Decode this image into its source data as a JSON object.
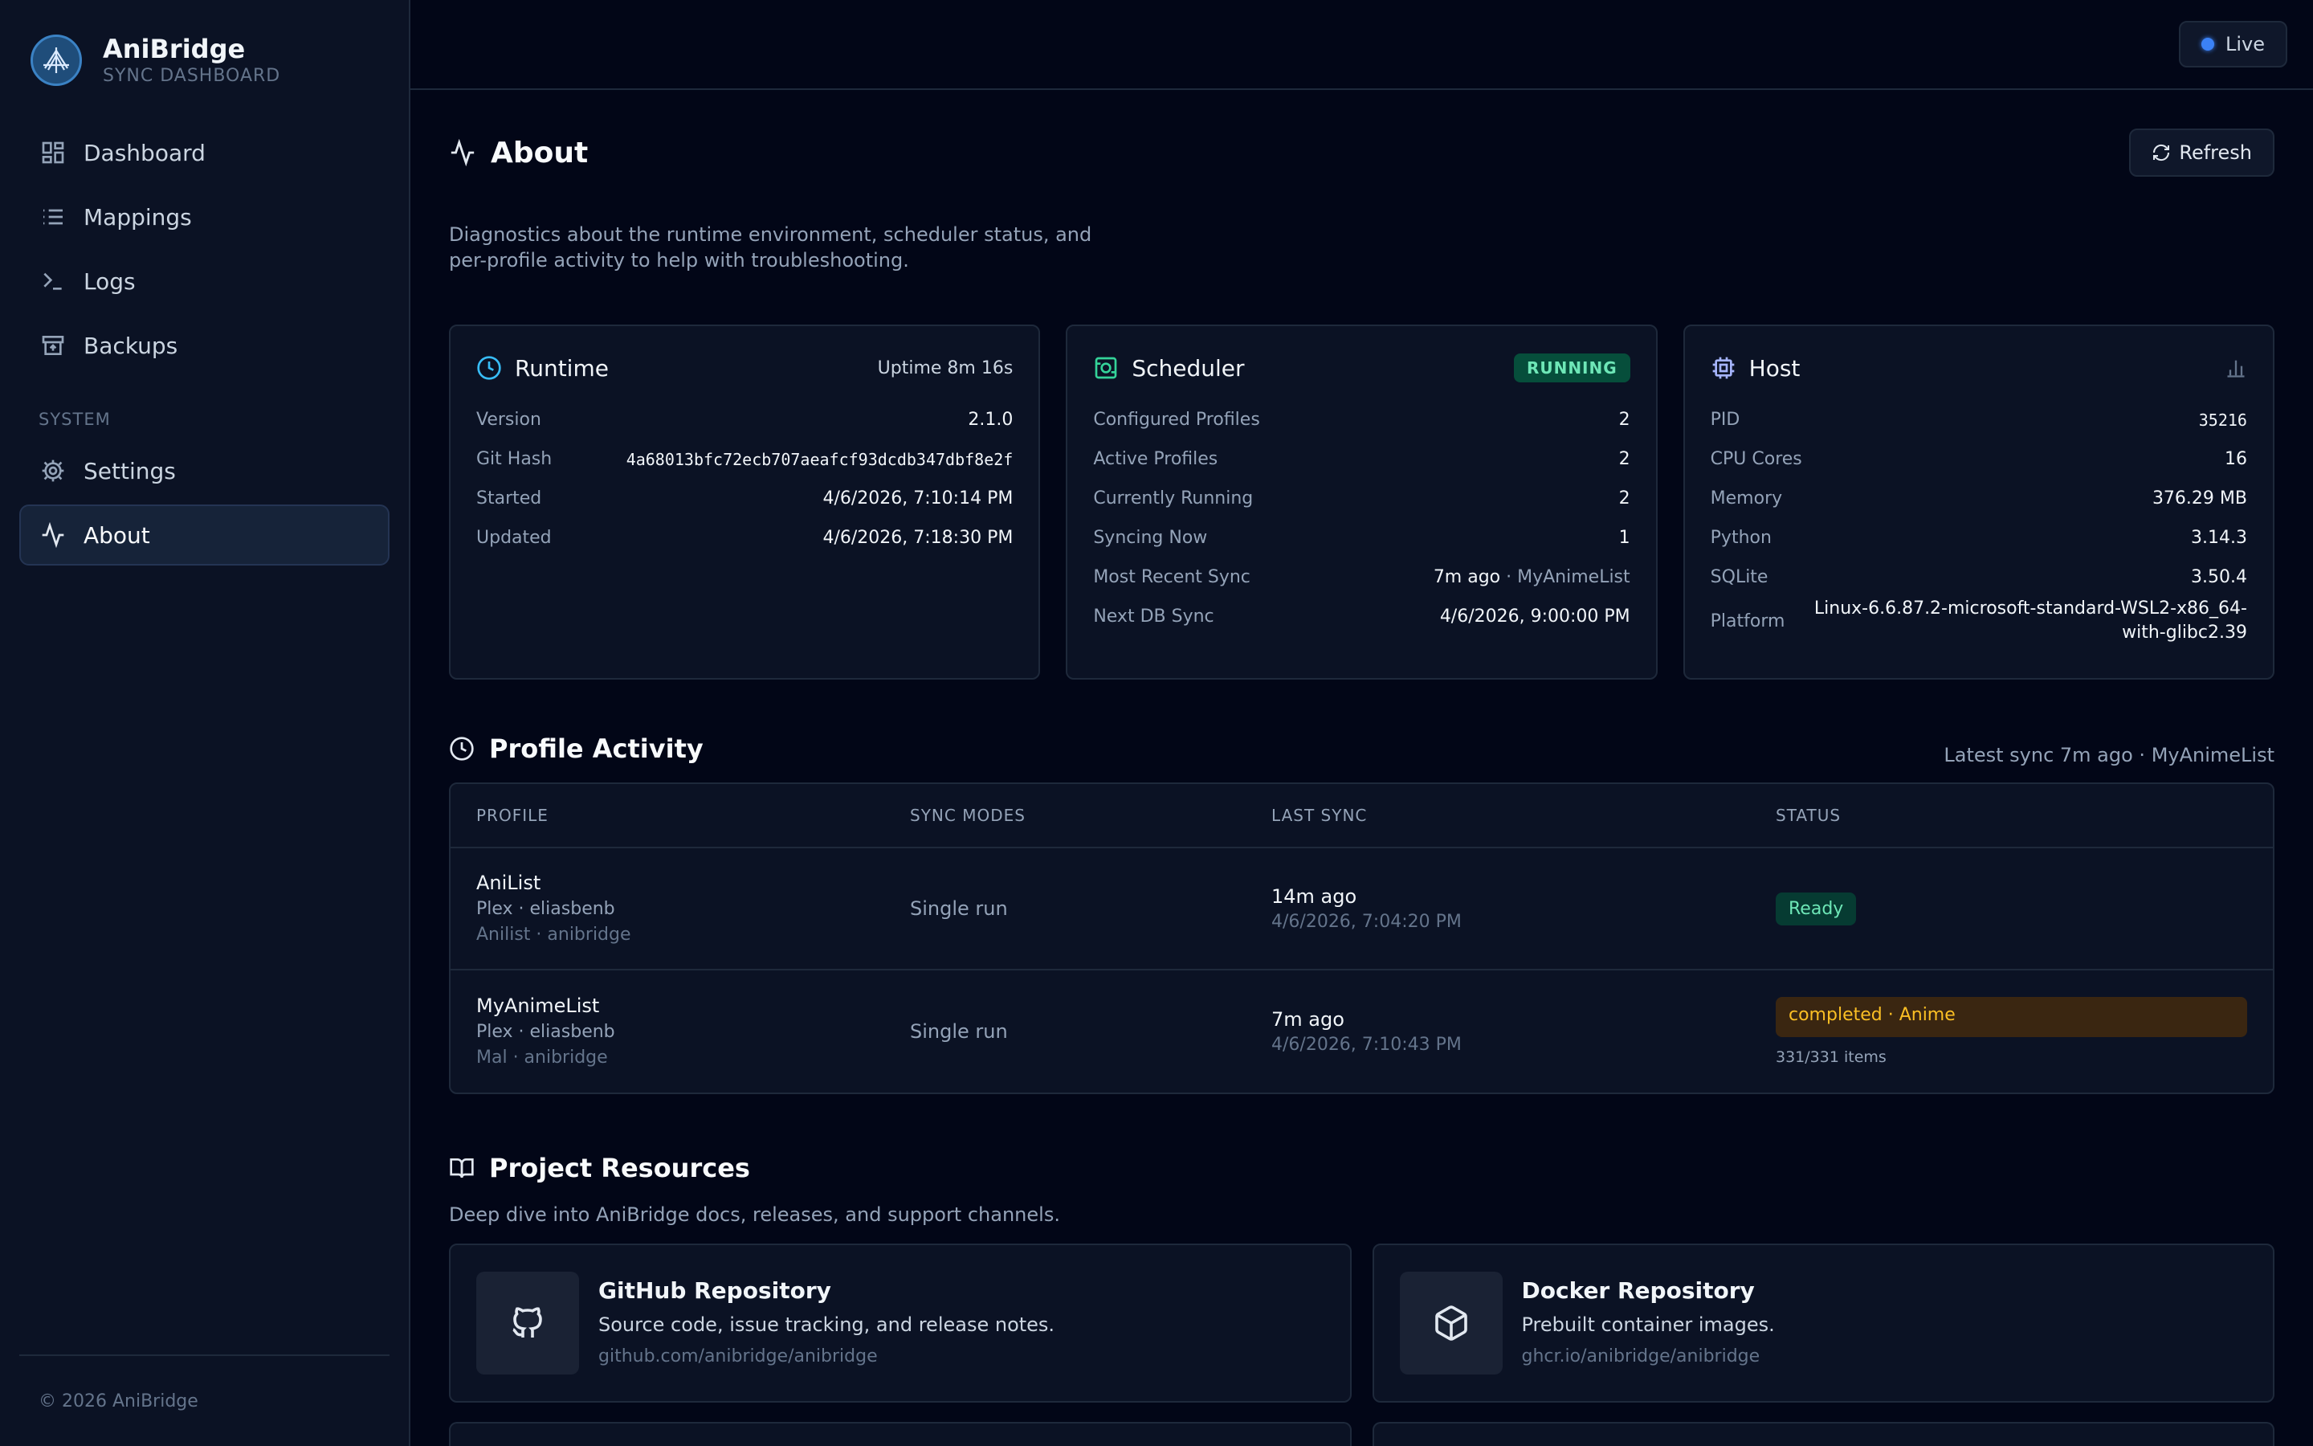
{
  "brand": {
    "title": "AniBridge",
    "subtitle": "SYNC DASHBOARD"
  },
  "nav": {
    "items": [
      {
        "label": "Dashboard",
        "icon": "dashboard-icon"
      },
      {
        "label": "Mappings",
        "icon": "list-icon"
      },
      {
        "label": "Logs",
        "icon": "terminal-icon"
      },
      {
        "label": "Backups",
        "icon": "archive-icon"
      }
    ],
    "section": "SYSTEM",
    "system_items": [
      {
        "label": "Settings",
        "icon": "gear-icon"
      },
      {
        "label": "About",
        "icon": "activity-icon",
        "active": true
      }
    ]
  },
  "footer": {
    "copyright": "© 2026 AniBridge"
  },
  "topbar": {
    "live_label": "Live"
  },
  "page": {
    "title": "About",
    "refresh_label": "Refresh",
    "description": "Diagnostics about the runtime environment, scheduler status, and per-profile activity to help with troubleshooting."
  },
  "runtime": {
    "title": "Runtime",
    "uptime": "Uptime 8m 16s",
    "rows": [
      {
        "k": "Version",
        "v": "2.1.0"
      },
      {
        "k": "Git Hash",
        "v": "4a68013bfc72ecb707aeafcf93dcdb347dbf8e2f"
      },
      {
        "k": "Started",
        "v": "4/6/2026, 7:10:14 PM"
      },
      {
        "k": "Updated",
        "v": "4/6/2026, 7:18:30 PM"
      }
    ]
  },
  "scheduler": {
    "title": "Scheduler",
    "status": "RUNNING",
    "rows": [
      {
        "k": "Configured Profiles",
        "v": "2"
      },
      {
        "k": "Active Profiles",
        "v": "2"
      },
      {
        "k": "Currently Running",
        "v": "2"
      },
      {
        "k": "Syncing Now",
        "v": "1"
      },
      {
        "k": "Most Recent Sync",
        "v": "7m ago",
        "v2": " · MyAnimeList"
      },
      {
        "k": "Next DB Sync",
        "v": "4/6/2026, 9:00:00 PM"
      }
    ]
  },
  "host": {
    "title": "Host",
    "rows": [
      {
        "k": "PID",
        "v": "35216"
      },
      {
        "k": "CPU Cores",
        "v": "16"
      },
      {
        "k": "Memory",
        "v": "376.29 MB"
      },
      {
        "k": "Python",
        "v": "3.14.3"
      },
      {
        "k": "SQLite",
        "v": "3.50.4"
      },
      {
        "k": "Platform",
        "v": "Linux-6.6.87.2-microsoft-standard-WSL2-x86_64-with-glibc2.39"
      }
    ]
  },
  "activity": {
    "title": "Profile Activity",
    "latest": "Latest sync 7m ago · MyAnimeList",
    "columns": [
      "PROFILE",
      "SYNC MODES",
      "LAST SYNC",
      "STATUS"
    ],
    "rows": [
      {
        "name": "AniList",
        "sub": "Plex · eliasbenb",
        "sub2": "Anilist · anibridge",
        "mode": "Single run",
        "last": "14m ago",
        "last_date": "4/6/2026, 7:04:20 PM",
        "status": "Ready"
      },
      {
        "name": "MyAnimeList",
        "sub": "Plex · eliasbenb",
        "sub2": "Mal · anibridge",
        "mode": "Single run",
        "last": "7m ago",
        "last_date": "4/6/2026, 7:10:43 PM",
        "status": "completed · Anime",
        "items": "331/331 items"
      }
    ]
  },
  "resources": {
    "title": "Project Resources",
    "description": "Deep dive into AniBridge docs, releases, and support channels.",
    "cards": [
      {
        "title": "GitHub Repository",
        "sub": "Source code, issue tracking, and release notes.",
        "link": "github.com/anibridge/anibridge",
        "icon": "github-icon"
      },
      {
        "title": "Docker Repository",
        "sub": "Prebuilt container images.",
        "link": "ghcr.io/anibridge/anibridge",
        "icon": "box-icon"
      }
    ]
  },
  "colors": {
    "accent": "#3b82f6",
    "success": "#6ee7b7",
    "warning": "#fbbf24",
    "background": "#020617"
  }
}
